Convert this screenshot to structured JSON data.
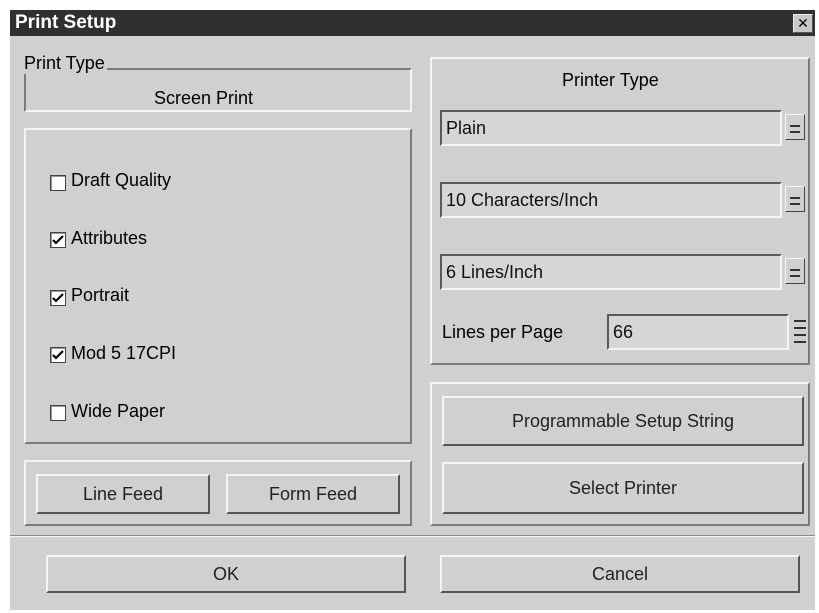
{
  "window": {
    "title": "Print Setup"
  },
  "print_type": {
    "label": "Print Type",
    "value": "Screen Print"
  },
  "options": [
    {
      "label": "Draft Quality",
      "checked": false
    },
    {
      "label": "Attributes",
      "checked": true
    },
    {
      "label": "Portrait",
      "checked": true
    },
    {
      "label": "Mod 5 17CPI",
      "checked": true
    },
    {
      "label": "Wide Paper",
      "checked": false
    }
  ],
  "feed_buttons": {
    "line_feed": "Line Feed",
    "form_feed": "Form Feed"
  },
  "printer_type": {
    "label": "Printer Type",
    "type_value": "Plain",
    "cpi_value": "10 Characters/Inch",
    "lpi_value": "6 Lines/Inch",
    "lines_per_page_label": "Lines per Page",
    "lines_per_page_value": "66"
  },
  "right_buttons": {
    "setup_string": "Programmable Setup String",
    "select_printer": "Select Printer"
  },
  "footer": {
    "ok": "OK",
    "cancel": "Cancel"
  }
}
